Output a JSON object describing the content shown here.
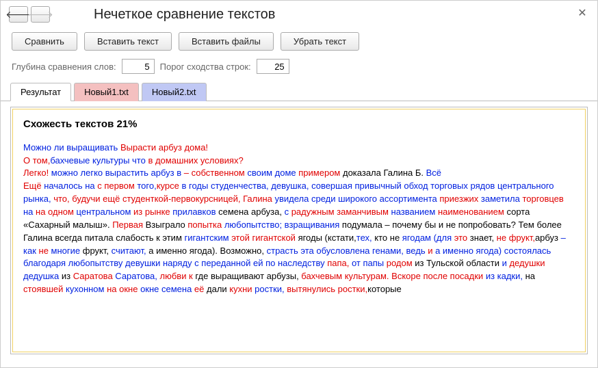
{
  "window": {
    "title": "Нечеткое сравнение текстов"
  },
  "toolbar": {
    "compare": "Сравнить",
    "insert_text": "Вставить текст",
    "insert_files": "Вставить файлы",
    "remove_text": "Убрать текст"
  },
  "params": {
    "depth_label": "Глубина сравнения слов:",
    "depth_value": "5",
    "threshold_label": "Порог сходства строк:",
    "threshold_value": "25"
  },
  "tabs": {
    "result": "Результат",
    "file1": "Новый1.txt",
    "file2": "Новый2.txt"
  },
  "result": {
    "heading": "Схожесть текстов 21%",
    "spans": [
      {
        "c": "b",
        "t": "Можно ли выращивать "
      },
      {
        "c": "r",
        "t": "Вырасти арбуз дома!"
      },
      {
        "c": "",
        "t": "\n"
      },
      {
        "c": "r",
        "t": "О том,"
      },
      {
        "c": "b",
        "t": "бахчевые культуры что "
      },
      {
        "c": "r",
        "t": "в домашних условиях?"
      },
      {
        "c": "",
        "t": "\n"
      },
      {
        "c": "r",
        "t": "Легко! "
      },
      {
        "c": "b",
        "t": "можно легко вырастить арбуз в "
      },
      {
        "c": "r",
        "t": "– собственном "
      },
      {
        "c": "b",
        "t": "своим доме "
      },
      {
        "c": "r",
        "t": "примером "
      },
      {
        "c": "",
        "t": "доказала Галина Б.\n"
      },
      {
        "c": "b",
        "t": "Всё"
      },
      {
        "c": "",
        "t": "\n"
      },
      {
        "c": "r",
        "t": "Ещё "
      },
      {
        "c": "b",
        "t": "началось на "
      },
      {
        "c": "r",
        "t": "с первом "
      },
      {
        "c": "b",
        "t": "того,"
      },
      {
        "c": "r",
        "t": "курсе "
      },
      {
        "c": "b",
        "t": "в годы студенчества, девушка, совершая привычный обход торговых рядов центрального рынка, "
      },
      {
        "c": "r",
        "t": "что, будучи ещё студенткой-первокурсницей, Галина "
      },
      {
        "c": "b",
        "t": "увидела среди широкого ассортимента "
      },
      {
        "c": "r",
        "t": "приезжих "
      },
      {
        "c": "b",
        "t": "заметила "
      },
      {
        "c": "r",
        "t": "торговцев "
      },
      {
        "c": "b",
        "t": "на "
      },
      {
        "c": "r",
        "t": "на одном "
      },
      {
        "c": "b",
        "t": "центральном "
      },
      {
        "c": "r",
        "t": "из рынке "
      },
      {
        "c": "b",
        "t": "прилавков "
      },
      {
        "c": "",
        "t": "семена арбуза, "
      },
      {
        "c": "b",
        "t": "с "
      },
      {
        "c": "r",
        "t": "радужным заманчивым "
      },
      {
        "c": "b",
        "t": "названием "
      },
      {
        "c": "r",
        "t": "наименованием "
      },
      {
        "c": "",
        "t": "сорта «Сахарный малыш». "
      },
      {
        "c": "r",
        "t": "Первая "
      },
      {
        "c": "",
        "t": "Взыграло "
      },
      {
        "c": "r",
        "t": "попытка "
      },
      {
        "c": "b",
        "t": "любопытство; взращивания "
      },
      {
        "c": "",
        "t": "подумала – почему бы и не попробовать? Тем более Галина всегда питала слабость к этим "
      },
      {
        "c": "b",
        "t": "гигантским "
      },
      {
        "c": "r",
        "t": "этой гигантской "
      },
      {
        "c": "",
        "t": "ягоды (кстати,"
      },
      {
        "c": "b",
        "t": "тех, "
      },
      {
        "c": "",
        "t": "кто не "
      },
      {
        "c": "b",
        "t": "ягодам (для "
      },
      {
        "c": "r",
        "t": "это "
      },
      {
        "c": "",
        "t": "знает, "
      },
      {
        "c": "r",
        "t": "не фрукт,"
      },
      {
        "c": "",
        "t": "арбуз "
      },
      {
        "c": "b",
        "t": "– как "
      },
      {
        "c": "r",
        "t": "не "
      },
      {
        "c": "b",
        "t": "многие "
      },
      {
        "c": "",
        "t": "фрукт, "
      },
      {
        "c": "b",
        "t": "считают, "
      },
      {
        "c": "",
        "t": "а именно ягода). Возможно, "
      },
      {
        "c": "b",
        "t": "страсть эта обусловлена генами, ведь "
      },
      {
        "c": "r",
        "t": "и "
      },
      {
        "c": "b",
        "t": "а именно ягода) состоялась благодаря любопытству девушки наряду с переданной ей по наследству "
      },
      {
        "c": "r",
        "t": "папа, "
      },
      {
        "c": "b",
        "t": "от папы "
      },
      {
        "c": "r",
        "t": "родом "
      },
      {
        "c": "",
        "t": "из Тульской области "
      },
      {
        "c": "b",
        "t": "и "
      },
      {
        "c": "r",
        "t": "дедушки "
      },
      {
        "c": "b",
        "t": "дедушка "
      },
      {
        "c": "",
        "t": "из "
      },
      {
        "c": "r",
        "t": "Саратова "
      },
      {
        "c": "b",
        "t": "Саратова, "
      },
      {
        "c": "r",
        "t": "любви к "
      },
      {
        "c": "",
        "t": "где выращивают арбузы, "
      },
      {
        "c": "r",
        "t": "бахчевым культурам. Вскоре после посадки "
      },
      {
        "c": "b",
        "t": "из кадки, "
      },
      {
        "c": "",
        "t": "на "
      },
      {
        "c": "r",
        "t": "стоявшей "
      },
      {
        "c": "b",
        "t": "кухонном "
      },
      {
        "c": "r",
        "t": "на окне "
      },
      {
        "c": "b",
        "t": "окне семена "
      },
      {
        "c": "r",
        "t": "её "
      },
      {
        "c": "",
        "t": "дали "
      },
      {
        "c": "r",
        "t": "кухни "
      },
      {
        "c": "b",
        "t": "ростки, "
      },
      {
        "c": "r",
        "t": "вытянулись ростки,"
      },
      {
        "c": "",
        "t": "которые"
      }
    ]
  }
}
